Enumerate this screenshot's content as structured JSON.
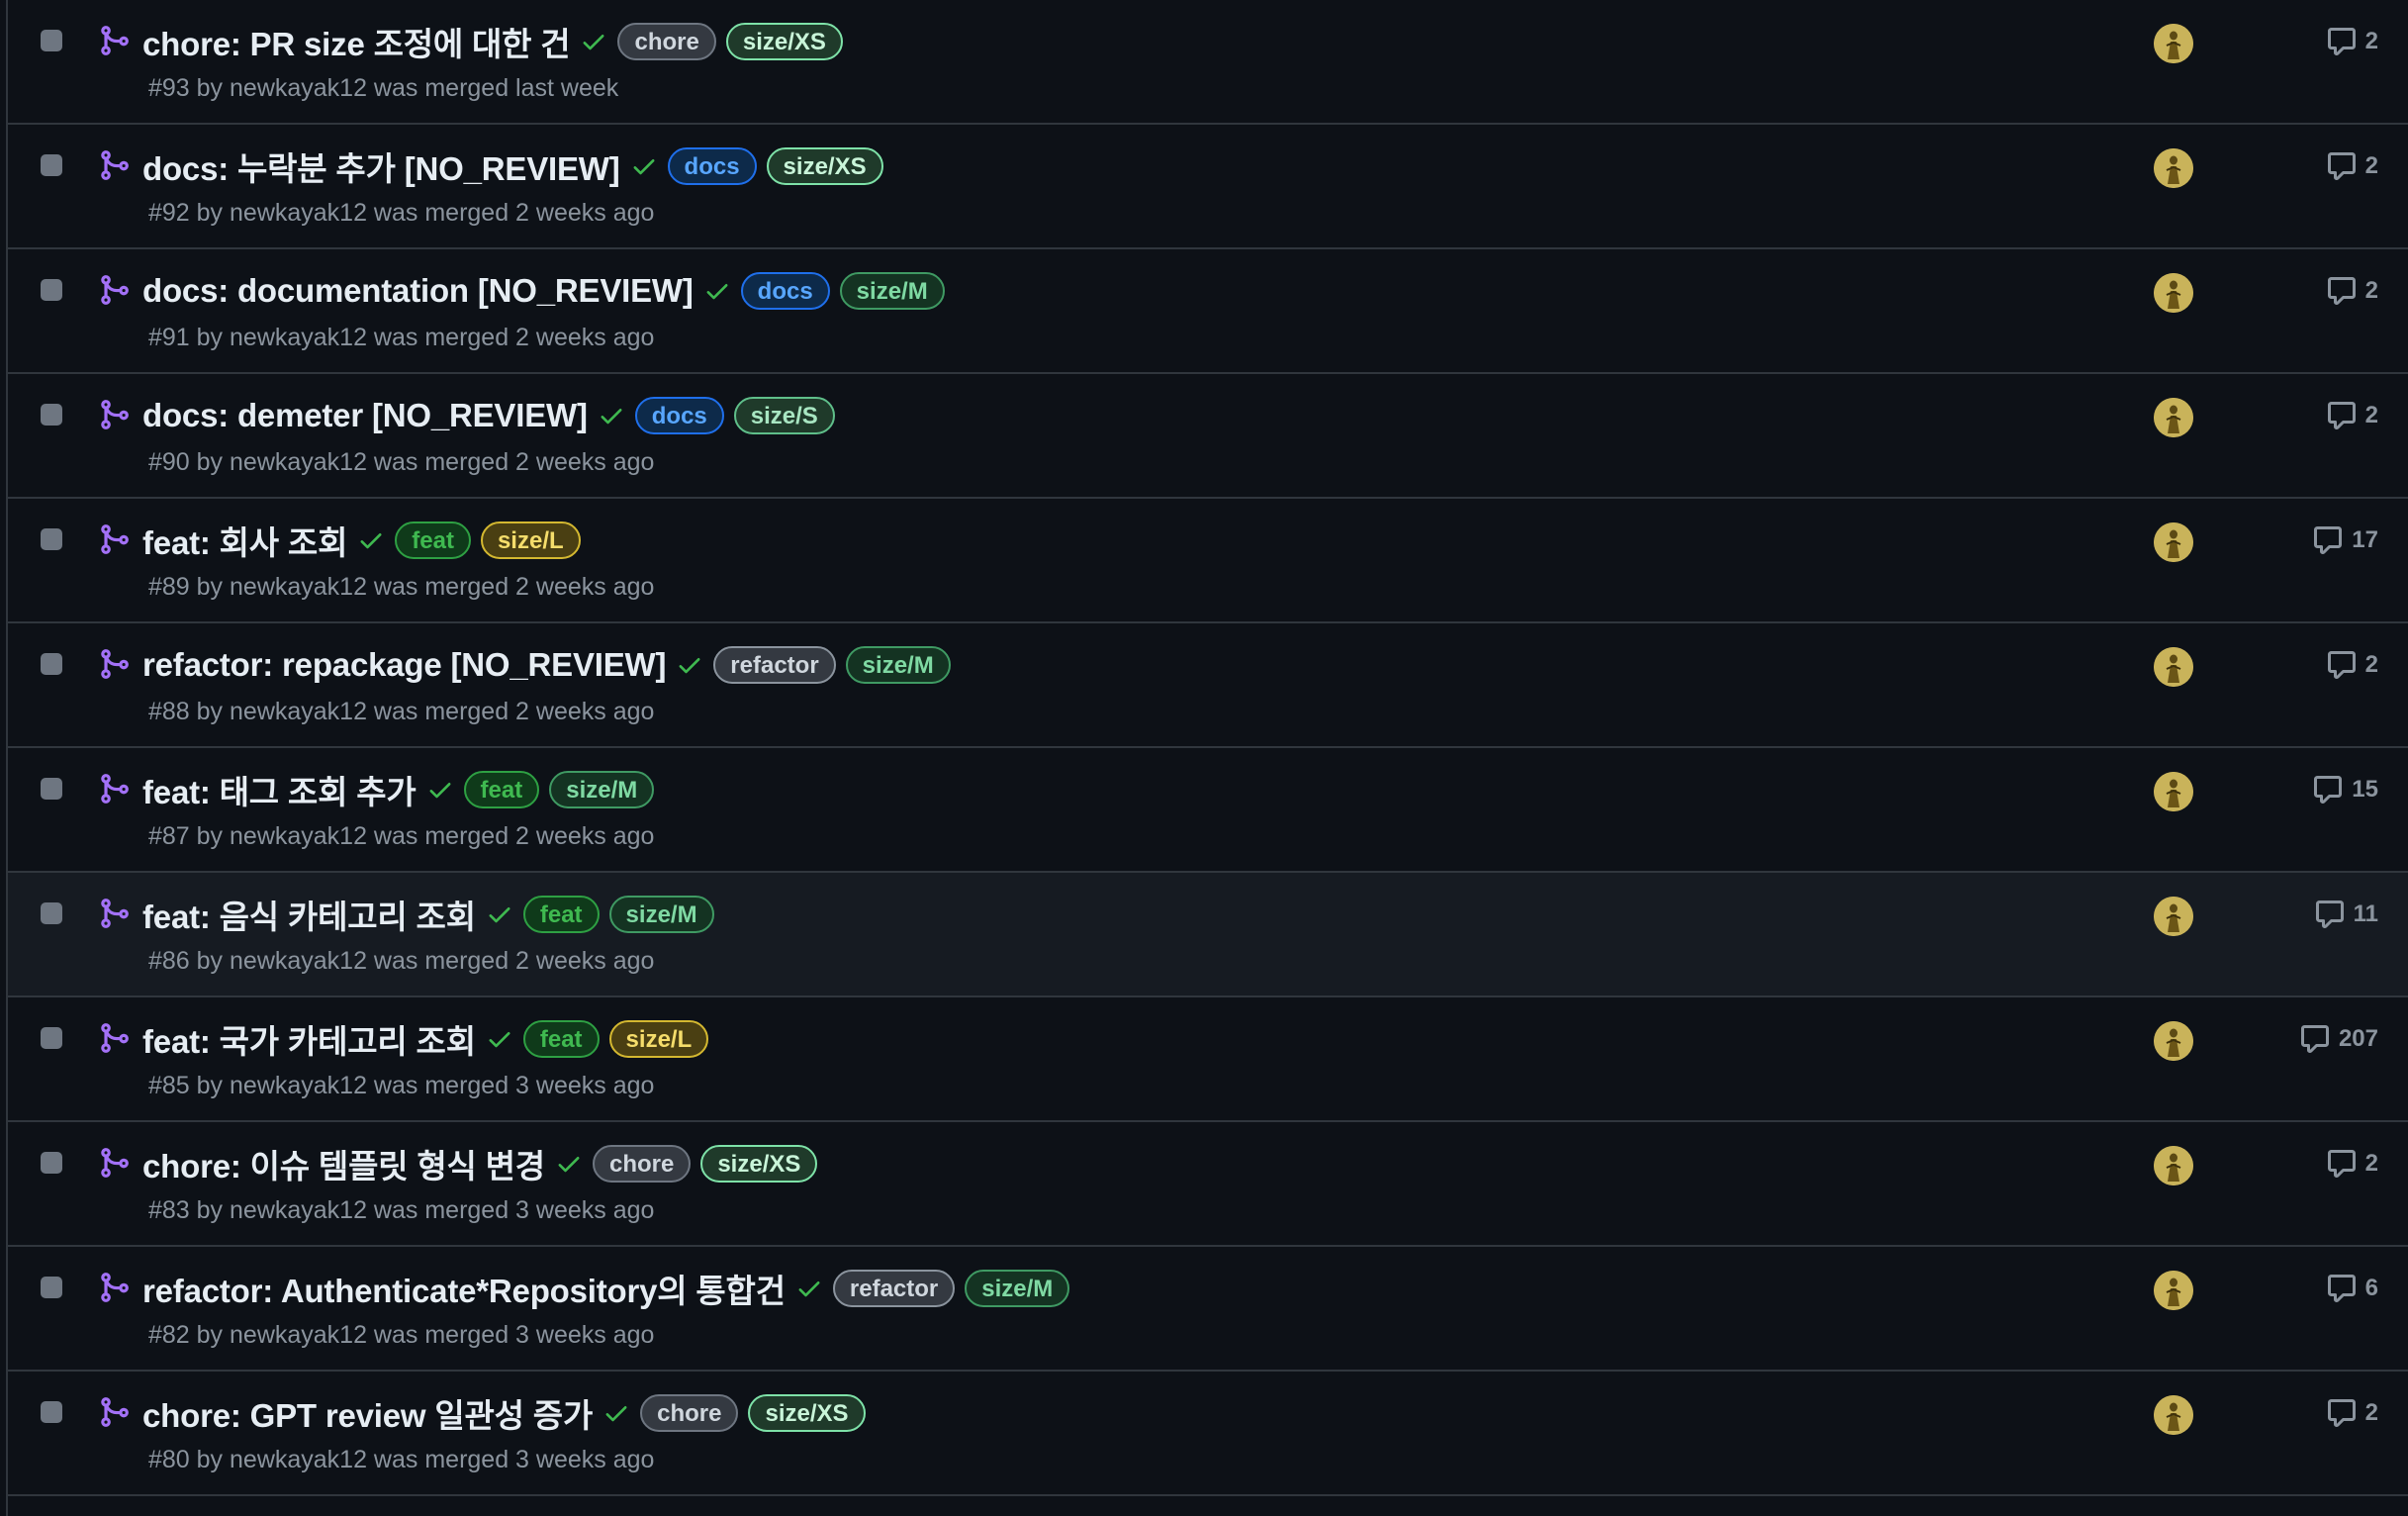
{
  "pull_requests": [
    {
      "title": "chore: PR size 조정에 대한 건",
      "labels": [
        {
          "text": "chore",
          "kind": "chore"
        },
        {
          "text": "size/XS",
          "kind": "size-xs"
        }
      ],
      "meta": "#93 by newkayak12 was merged last week",
      "comments": "2"
    },
    {
      "title": "docs: 누락분 추가 [NO_REVIEW]",
      "labels": [
        {
          "text": "docs",
          "kind": "docs"
        },
        {
          "text": "size/XS",
          "kind": "size-xs"
        }
      ],
      "meta": "#92 by newkayak12 was merged 2 weeks ago",
      "comments": "2"
    },
    {
      "title": "docs: documentation [NO_REVIEW]",
      "labels": [
        {
          "text": "docs",
          "kind": "docs"
        },
        {
          "text": "size/M",
          "kind": "size-m"
        }
      ],
      "meta": "#91 by newkayak12 was merged 2 weeks ago",
      "comments": "2"
    },
    {
      "title": "docs: demeter [NO_REVIEW]",
      "labels": [
        {
          "text": "docs",
          "kind": "docs"
        },
        {
          "text": "size/S",
          "kind": "size-s"
        }
      ],
      "meta": "#90 by newkayak12 was merged 2 weeks ago",
      "comments": "2"
    },
    {
      "title": "feat: 회사 조회",
      "labels": [
        {
          "text": "feat",
          "kind": "feat"
        },
        {
          "text": "size/L",
          "kind": "size-l"
        }
      ],
      "meta": "#89 by newkayak12 was merged 2 weeks ago",
      "comments": "17"
    },
    {
      "title": "refactor: repackage [NO_REVIEW]",
      "labels": [
        {
          "text": "refactor",
          "kind": "refactor"
        },
        {
          "text": "size/M",
          "kind": "size-m"
        }
      ],
      "meta": "#88 by newkayak12 was merged 2 weeks ago",
      "comments": "2"
    },
    {
      "title": "feat: 태그 조회 추가",
      "labels": [
        {
          "text": "feat",
          "kind": "feat"
        },
        {
          "text": "size/M",
          "kind": "size-m"
        }
      ],
      "meta": "#87 by newkayak12 was merged 2 weeks ago",
      "comments": "15"
    },
    {
      "title": "feat: 음식 카테고리 조회",
      "labels": [
        {
          "text": "feat",
          "kind": "feat"
        },
        {
          "text": "size/M",
          "kind": "size-m"
        }
      ],
      "meta": "#86 by newkayak12 was merged 2 weeks ago",
      "comments": "11",
      "hover": true
    },
    {
      "title": "feat: 국가 카테고리 조회",
      "labels": [
        {
          "text": "feat",
          "kind": "feat"
        },
        {
          "text": "size/L",
          "kind": "size-l"
        }
      ],
      "meta": "#85 by newkayak12 was merged 3 weeks ago",
      "comments": "207"
    },
    {
      "title": "chore: 이슈 템플릿 형식 변경",
      "labels": [
        {
          "text": "chore",
          "kind": "chore"
        },
        {
          "text": "size/XS",
          "kind": "size-xs"
        }
      ],
      "meta": "#83 by newkayak12 was merged 3 weeks ago",
      "comments": "2"
    },
    {
      "title": "refactor: Authenticate*Repository의 통합건",
      "labels": [
        {
          "text": "refactor",
          "kind": "refactor"
        },
        {
          "text": "size/M",
          "kind": "size-m"
        }
      ],
      "meta": "#82 by newkayak12 was merged 3 weeks ago",
      "comments": "6"
    },
    {
      "title": "chore: GPT review 일관성 증가",
      "labels": [
        {
          "text": "chore",
          "kind": "chore"
        },
        {
          "text": "size/XS",
          "kind": "size-xs"
        }
      ],
      "meta": "#80 by newkayak12 was merged 3 weeks ago",
      "comments": "2"
    }
  ],
  "icons": {
    "merge": "git-merge-icon",
    "check": "check-icon",
    "comment": "comment-icon",
    "avatar": "avatar"
  },
  "colors": {
    "background": "#0d1117",
    "border": "#30363d",
    "merged_purple": "#a371f7",
    "success_green": "#3fb950",
    "muted_text": "#8b949e",
    "title_text": "#e6edf3"
  }
}
